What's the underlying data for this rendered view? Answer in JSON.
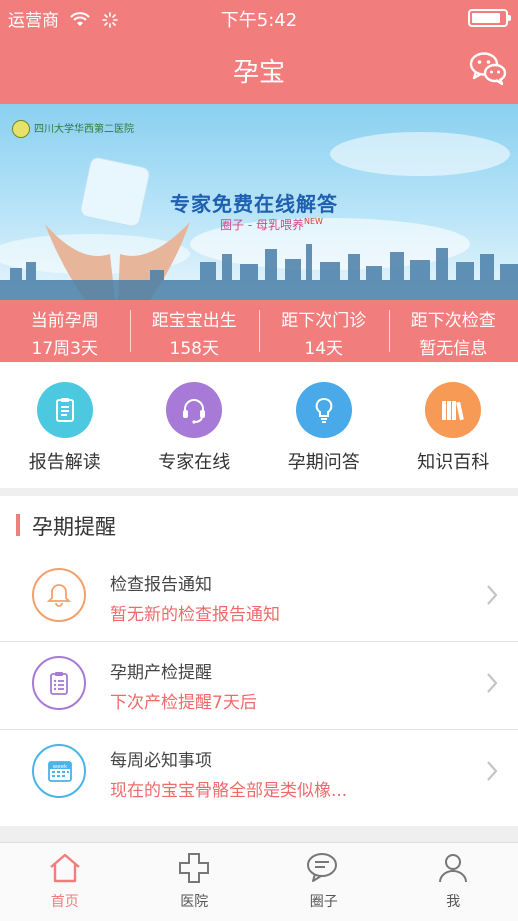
{
  "status_bar": {
    "carrier": "运营商",
    "time": "下午5:42"
  },
  "nav": {
    "title": "孕宝"
  },
  "banner": {
    "hospital": "四川大学华西第二医院",
    "headline": "专家免费在线解答",
    "sub": "圈子 - 母乳喂养",
    "new_badge": "NEW"
  },
  "stats": [
    {
      "label": "当前孕周",
      "value": "17周3天"
    },
    {
      "label": "距宝宝出生",
      "value": "158天"
    },
    {
      "label": "距下次门诊",
      "value": "14天"
    },
    {
      "label": "距下次检查",
      "value": "暂无信息"
    }
  ],
  "quick_actions": [
    {
      "label": "报告解读",
      "icon": "clipboard-icon",
      "color": "#4cc8e0"
    },
    {
      "label": "专家在线",
      "icon": "headset-icon",
      "color": "#a67ad6"
    },
    {
      "label": "孕期问答",
      "icon": "lightbulb-icon",
      "color": "#4aa9e8"
    },
    {
      "label": "知识百科",
      "icon": "books-icon",
      "color": "#f79a55"
    }
  ],
  "reminders": {
    "title": "孕期提醒",
    "items": [
      {
        "title": "检查报告通知",
        "subtitle": "暂无新的检查报告通知",
        "icon": "bell-icon",
        "color": "#f4a06a"
      },
      {
        "title": "孕期产检提醒",
        "subtitle": "下次产检提醒7天后",
        "icon": "checklist-icon",
        "color": "#a67ad6"
      },
      {
        "title": "每周必知事项",
        "subtitle": "现在的宝宝骨骼全部是类似橡...",
        "icon": "calendar-icon",
        "color": "#4ab3e8",
        "calendar_text": "week"
      }
    ]
  },
  "tabbar": [
    {
      "label": "首页",
      "icon": "home-icon",
      "active": true
    },
    {
      "label": "医院",
      "icon": "cross-icon",
      "active": false
    },
    {
      "label": "圈子",
      "icon": "chat-icon",
      "active": false
    },
    {
      "label": "我",
      "icon": "user-icon",
      "active": false
    }
  ],
  "colors": {
    "primary": "#f27d7d",
    "accent_text": "#ef6a6a"
  }
}
